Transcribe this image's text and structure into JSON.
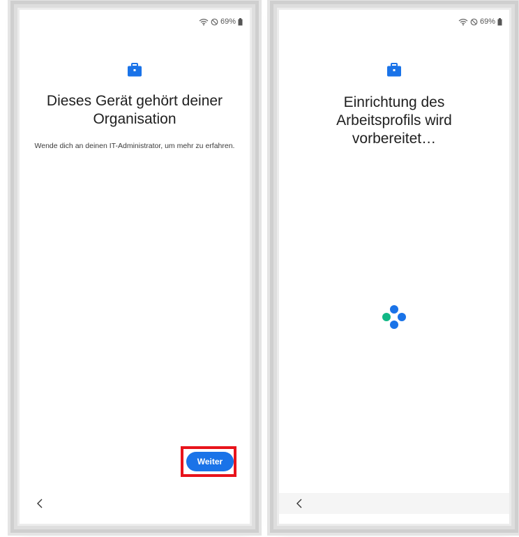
{
  "left_screen": {
    "status": {
      "battery_text": "69%"
    },
    "title": "Dieses Gerät gehört deiner Organisation",
    "subtitle": "Wende dich an deinen IT-Administrator, um mehr zu erfahren.",
    "next_button_label": "Weiter"
  },
  "right_screen": {
    "status": {
      "battery_text": "69%"
    },
    "title": "Einrichtung des Arbeitsprofils wird vorbereitet…"
  },
  "colors": {
    "accent": "#1a73e8",
    "highlight": "#e8131b",
    "loader_green": "#12b886"
  },
  "icons": [
    "wifi-icon",
    "do-not-disturb-icon",
    "battery-icon",
    "briefcase-icon",
    "back-arrow-icon",
    "loading-spinner-icon"
  ]
}
